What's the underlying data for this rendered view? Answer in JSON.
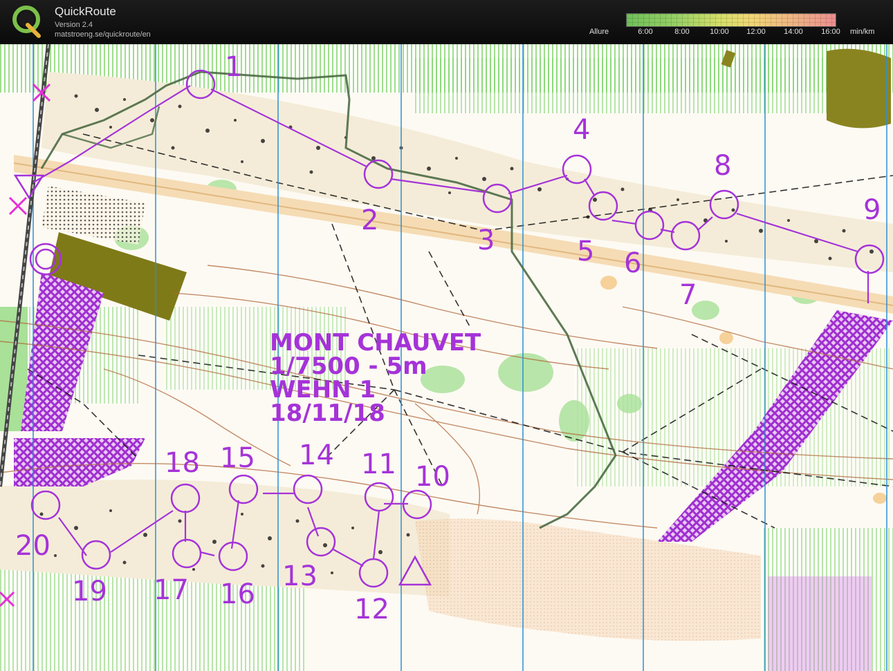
{
  "app": {
    "name": "QuickRoute",
    "version": "Version 2.4",
    "url": "matstroeng.se/quickroute/en"
  },
  "pace_legend": {
    "label": "Allure",
    "ticks": [
      "6:00",
      "8:00",
      "10:00",
      "12:00",
      "14:00",
      "16:00"
    ],
    "unit": "min/km"
  },
  "map": {
    "title_lines": [
      "MONT CHAUVET",
      "1/7500 - 5m",
      "WEHN 1",
      "18/11/18"
    ],
    "controls": [
      "1",
      "2",
      "3",
      "4",
      "5",
      "6",
      "7",
      "8",
      "9",
      "10",
      "11",
      "12",
      "13",
      "14",
      "15",
      "16",
      "17",
      "18",
      "19",
      "20"
    ],
    "colors": {
      "course": "#a533d8",
      "route": "#4d6b45",
      "vegetation": "#6cc45a",
      "olive": "#7f7a18"
    }
  }
}
